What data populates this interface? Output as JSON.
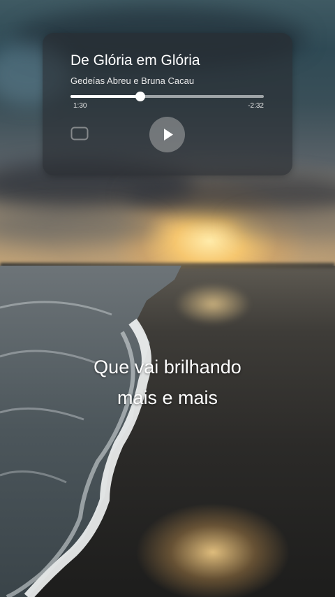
{
  "player": {
    "title": "De Glória em Glória",
    "artist": "Gedeías Abreu e Bruna Cacau",
    "progress": 0.36,
    "elapsed": "1:30",
    "remaining": "-2:32",
    "icons": {
      "cast": "cast-icon",
      "play": "play-icon"
    }
  },
  "lyrics": {
    "line1": "Que vai brilhando",
    "line2": "mais e mais"
  },
  "colors": {
    "card_background": "#282c30",
    "text": "#ffffff"
  }
}
